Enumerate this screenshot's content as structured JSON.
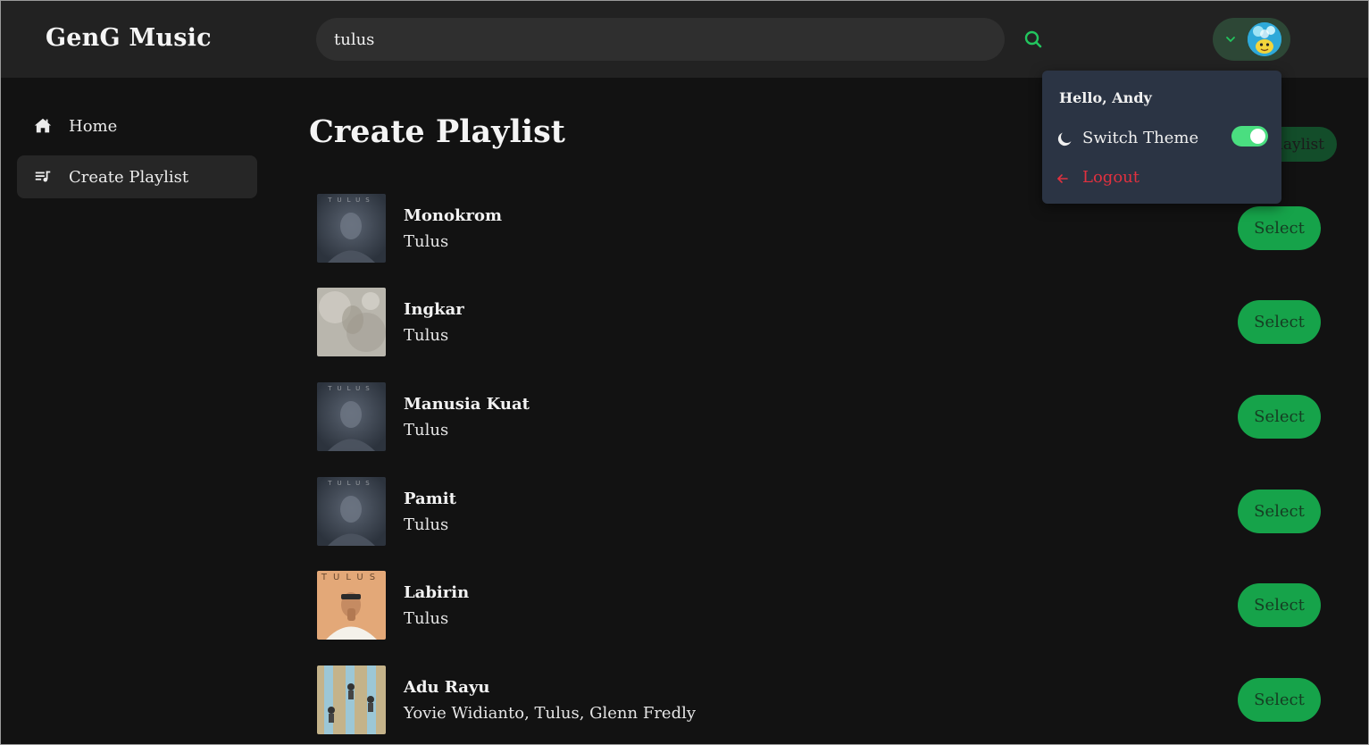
{
  "app": {
    "title": "GenG Music"
  },
  "search": {
    "value": "tulus"
  },
  "sidebar": {
    "items": [
      {
        "label": "Home",
        "icon": "home-icon",
        "active": false
      },
      {
        "label": "Create Playlist",
        "icon": "playlist-add-icon",
        "active": true
      }
    ]
  },
  "main": {
    "title": "Create Playlist",
    "create_button_label": "laylist",
    "select_label": "Select",
    "songs": [
      {
        "title": "Monokrom",
        "artist": "Tulus",
        "cover_label": "TULUS"
      },
      {
        "title": "Ingkar",
        "artist": "Tulus",
        "cover_label": ""
      },
      {
        "title": "Manusia Kuat",
        "artist": "Tulus",
        "cover_label": "TULUS"
      },
      {
        "title": "Pamit",
        "artist": "Tulus",
        "cover_label": "TULUS"
      },
      {
        "title": "Labirin",
        "artist": "Tulus",
        "cover_label": "TULUS"
      },
      {
        "title": "Adu Rayu",
        "artist": "Yovie Widianto, Tulus, Glenn Fredly",
        "cover_label": ""
      }
    ]
  },
  "profile_menu": {
    "greeting": "Hello, Andy",
    "switch_theme_label": "Switch Theme",
    "theme_toggle_on": true,
    "logout_label": "Logout"
  },
  "colors": {
    "accent": "#16a34a",
    "toggle": "#4ade80",
    "logout": "#e0313f",
    "header": "#222222",
    "background": "#121212"
  }
}
